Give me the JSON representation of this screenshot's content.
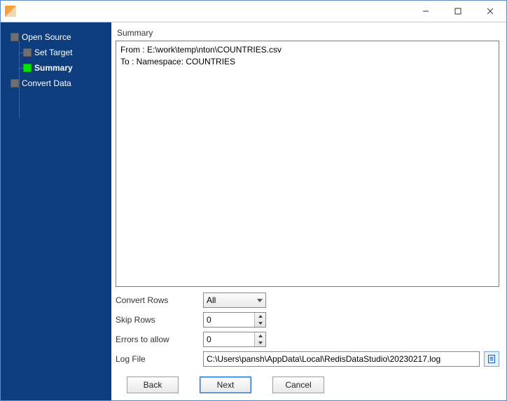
{
  "sidebar": {
    "items": [
      {
        "label": "Open Source",
        "active": false,
        "child": false
      },
      {
        "label": "Set Target",
        "active": false,
        "child": true
      },
      {
        "label": "Summary",
        "active": true,
        "child": true
      },
      {
        "label": "Convert Data",
        "active": false,
        "child": false
      }
    ]
  },
  "section_title": "Summary",
  "summary": {
    "line1": "From : E:\\work\\temp\\nton\\COUNTRIES.csv",
    "line2": "To : Namespace: COUNTRIES"
  },
  "form": {
    "convert_rows": {
      "label": "Convert Rows",
      "value": "All"
    },
    "skip_rows": {
      "label": "Skip Rows",
      "value": "0"
    },
    "errors": {
      "label": "Errors to allow",
      "value": "0"
    },
    "log_file": {
      "label": "Log File",
      "value": "C:\\Users\\pansh\\AppData\\Local\\RedisDataStudio\\20230217.log"
    }
  },
  "buttons": {
    "back": "Back",
    "next": "Next",
    "cancel": "Cancel"
  }
}
